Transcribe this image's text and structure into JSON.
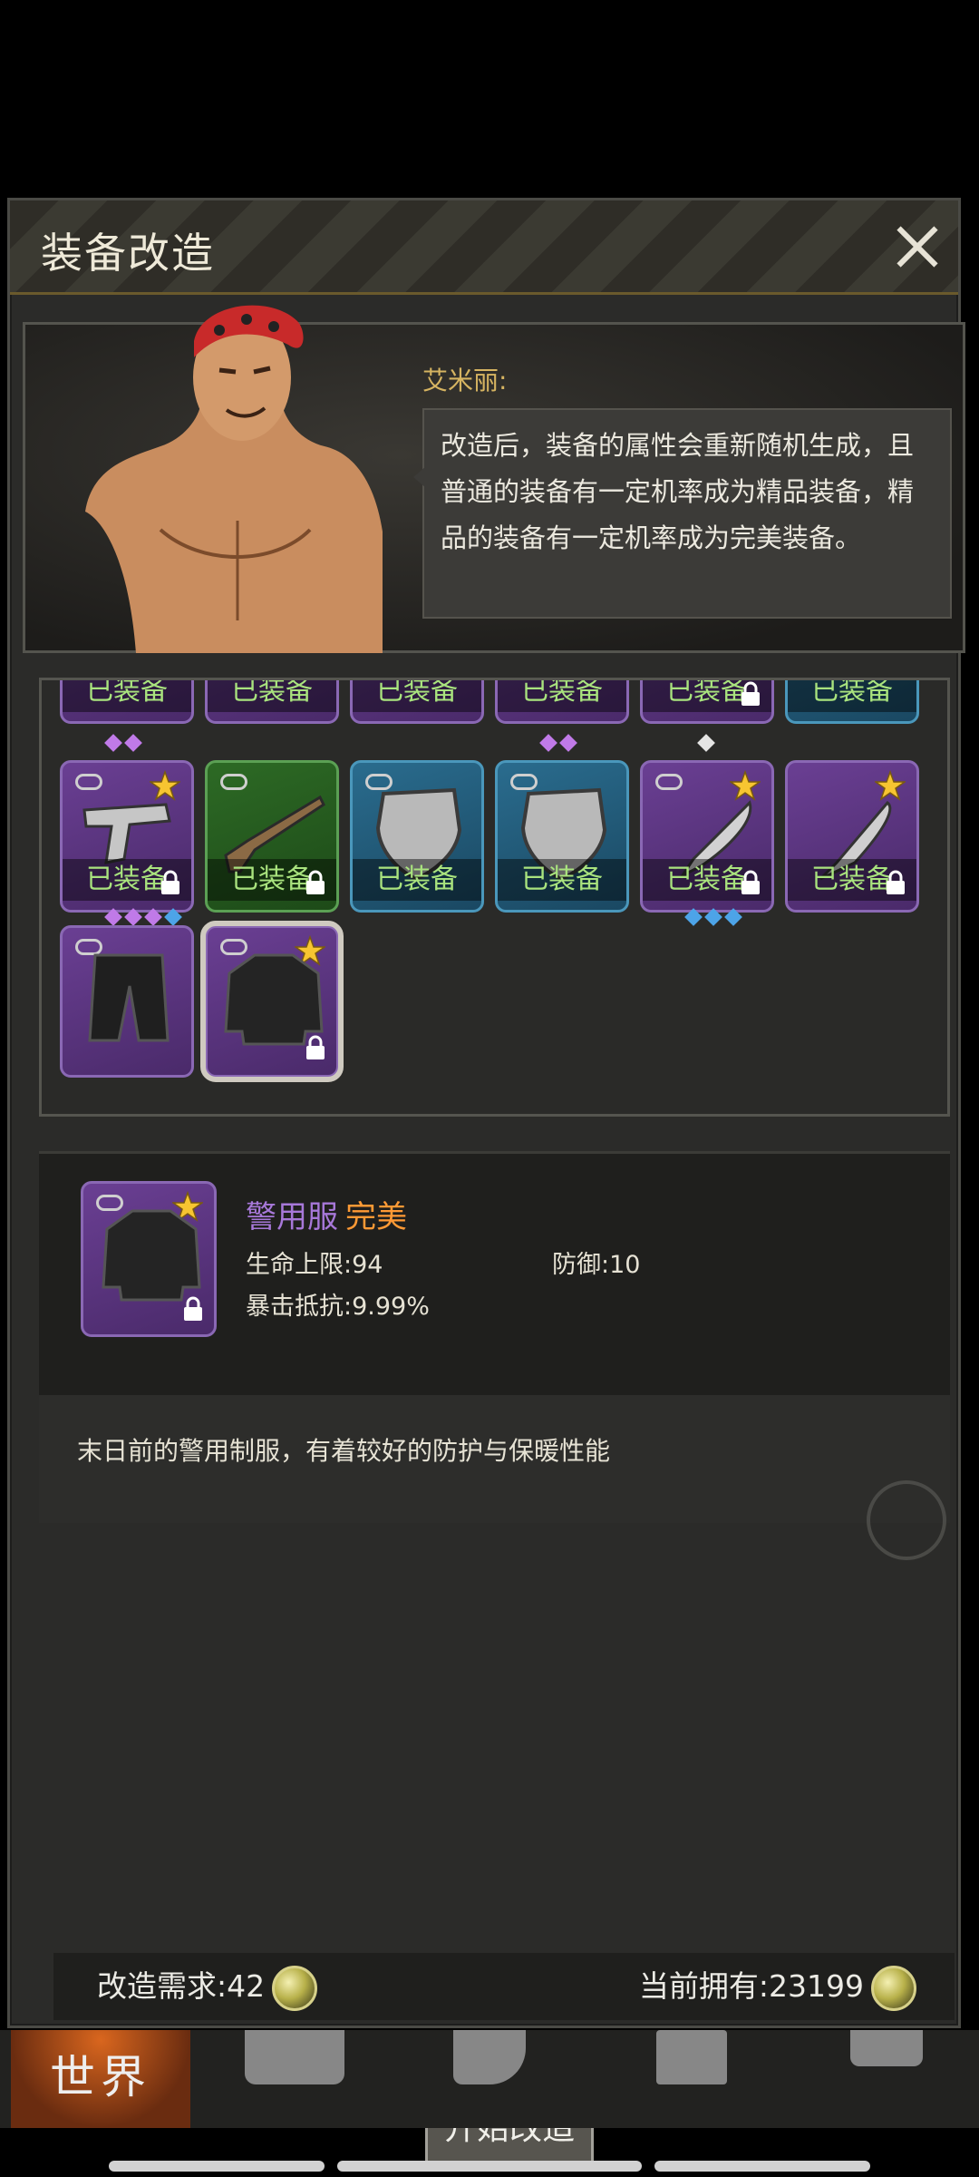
{
  "modal": {
    "title": "装备改造"
  },
  "npc": {
    "name": "艾米丽:",
    "speech": [
      "改造后，装备的属性会重新随机生成，且",
      "普通的装备有一定机率成为精品装备，精",
      "品的装备有一定机率成为完美装备。"
    ]
  },
  "inventory": {
    "equipped_label": "已装备",
    "row1_rarities": [
      "purple",
      "purple",
      "purple",
      "purple",
      "purple",
      "blue"
    ],
    "row2": [
      {
        "type": "pistol-icon",
        "rarity": "purple",
        "equipped": true
      },
      {
        "type": "shotgun-icon",
        "rarity": "green",
        "equipped": true
      },
      {
        "type": "shield-icon",
        "rarity": "blue",
        "equipped": true
      },
      {
        "type": "shield-icon",
        "rarity": "blue",
        "equipped": true
      },
      {
        "type": "machete-icon",
        "rarity": "purple",
        "equipped": true
      },
      {
        "type": "knife-icon",
        "rarity": "purple",
        "equipped": true
      }
    ],
    "row3": [
      {
        "type": "pants-icon",
        "rarity": "purple",
        "equipped": false
      },
      {
        "type": "jacket-icon",
        "rarity": "purple",
        "equipped": false,
        "selected": true
      }
    ]
  },
  "detail": {
    "name": "警用服",
    "quality": "完美",
    "stats": {
      "hp": "生命上限:94",
      "defense": "防御:10",
      "crit_resist": "暴击抵抗:9.99%"
    },
    "description": "末日前的警用制服，有着较好的防护与保暖性能"
  },
  "cost": {
    "required": "改造需求:42",
    "owned": "当前拥有:23199"
  },
  "start_button": "开始改造",
  "nav": {
    "world": "世界"
  },
  "colors": {
    "accent": "#d6b461",
    "equipped_text": "#a9e37e",
    "perfect": "#ff9a35",
    "epic_name": "#a778d9"
  }
}
